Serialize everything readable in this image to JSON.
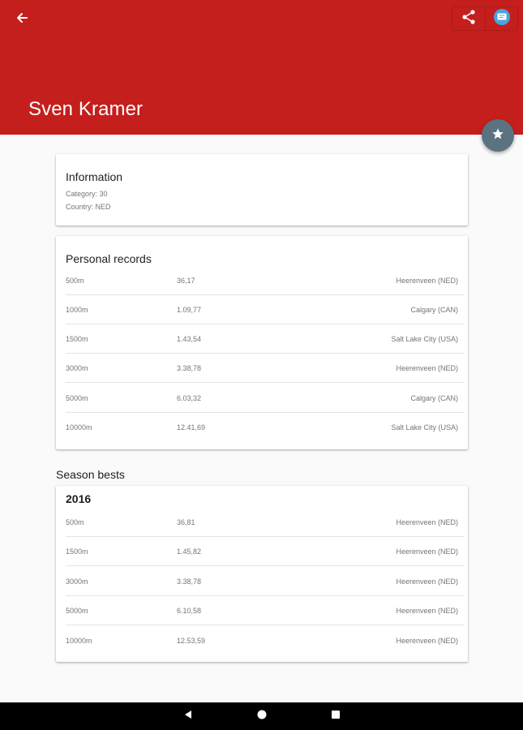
{
  "app_bar": {
    "title": "Sven Kramer",
    "color": "#c41f1d",
    "back_icon": "arrow-back-icon",
    "share_icon": "share-icon",
    "cast_icon": "chat-bubble-icon"
  },
  "fab": {
    "icon": "star-icon",
    "color": "#5b7381"
  },
  "information": {
    "title": "Information",
    "category_line": "Category:  30",
    "country_line": "Country:  NED"
  },
  "personal_records": {
    "title": "Personal records",
    "rows": [
      {
        "distance": "500m",
        "time": "36,17",
        "location": "Heerenveen (NED)"
      },
      {
        "distance": "1000m",
        "time": "1.09,77",
        "location": "Calgary (CAN)"
      },
      {
        "distance": "1500m",
        "time": "1.43,54",
        "location": "Salt Lake City (USA)"
      },
      {
        "distance": "3000m",
        "time": "3.38,78",
        "location": "Heerenveen (NED)"
      },
      {
        "distance": "5000m",
        "time": "6.03,32",
        "location": "Calgary (CAN)"
      },
      {
        "distance": "10000m",
        "time": "12.41,69",
        "location": "Salt Lake City (USA)"
      }
    ]
  },
  "season_bests": {
    "title": "Season bests",
    "year": "2016",
    "rows": [
      {
        "distance": "500m",
        "time": "36,81",
        "location": "Heerenveen (NED)"
      },
      {
        "distance": "1500m",
        "time": "1.45,82",
        "location": "Heerenveen (NED)"
      },
      {
        "distance": "3000m",
        "time": "3.38,78",
        "location": "Heerenveen (NED)"
      },
      {
        "distance": "5000m",
        "time": "6.10,58",
        "location": "Heerenveen (NED)"
      },
      {
        "distance": "10000m",
        "time": "12.53,59",
        "location": "Heerenveen (NED)"
      }
    ]
  },
  "nav_bar": {
    "back_icon": "nav-back-triangle-icon",
    "home_icon": "nav-home-circle-icon",
    "recents_icon": "nav-recents-square-icon"
  }
}
